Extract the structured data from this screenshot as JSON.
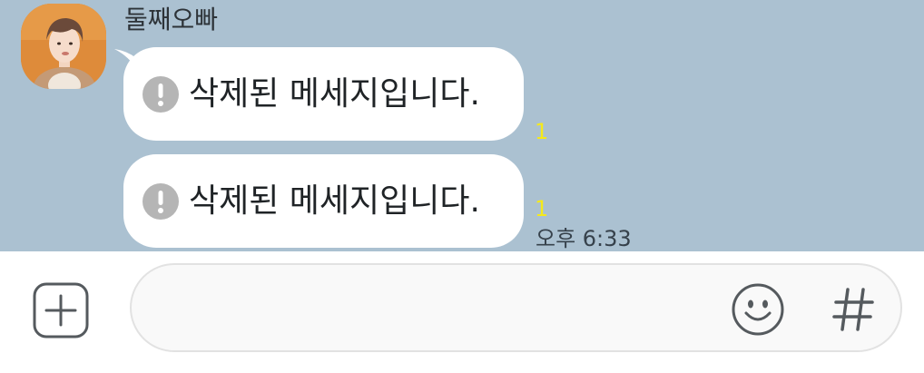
{
  "chat": {
    "sender_name": "둘째오빠",
    "messages": [
      {
        "text": "삭제된 메세지입니다.",
        "unread_count": "1",
        "icon": "alert-circle-icon"
      },
      {
        "text": "삭제된 메세지입니다.",
        "unread_count": "1",
        "icon": "alert-circle-icon"
      }
    ],
    "timestamp": "오후 6:33"
  },
  "input_bar": {
    "message_value": "",
    "plus_icon": "plus-square-icon",
    "emoji_icon": "smiley-icon",
    "hash_icon": "hash-icon"
  },
  "colors": {
    "chat_background": "#abc1d1",
    "bubble": "#ffffff",
    "unread_badge": "#f5e91b",
    "icon_gray": "#b5b5b5"
  }
}
